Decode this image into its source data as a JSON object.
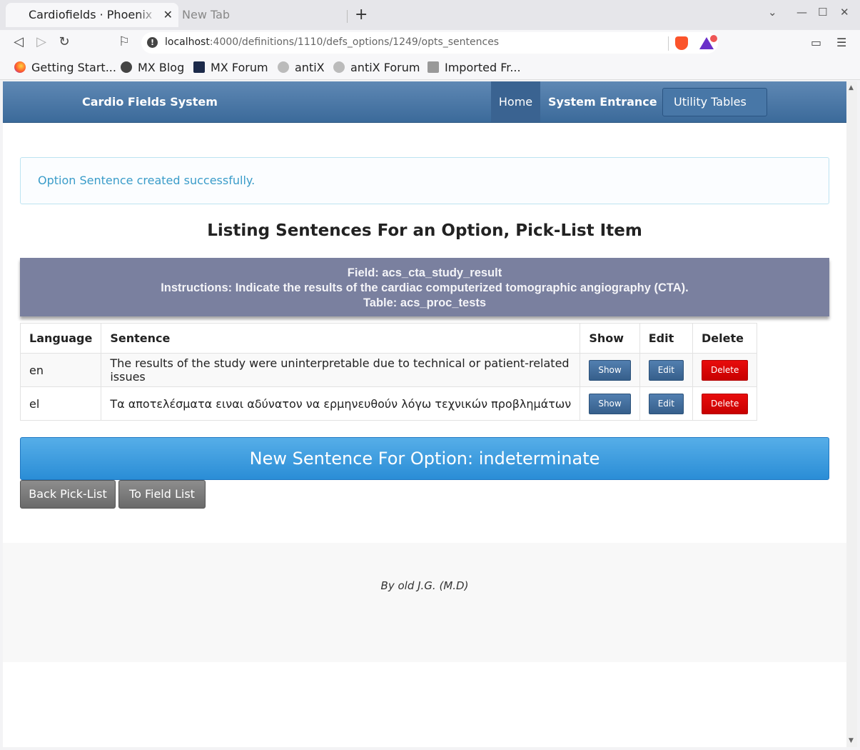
{
  "browser": {
    "tabs": [
      {
        "title": "Cardiofields · Phoenix Framework"
      },
      {
        "title": "New Tab"
      }
    ],
    "url": {
      "host": "localhost",
      "rest": ":4000/definitions/1110/defs_options/1249/opts_sentences"
    },
    "bookmarks": [
      {
        "label": "Getting Start...",
        "icon": "firefox-icon"
      },
      {
        "label": "MX Blog",
        "icon": "globe-icon"
      },
      {
        "label": "MX Forum",
        "icon": "mx-icon"
      },
      {
        "label": "antiX",
        "icon": "antix-icon"
      },
      {
        "label": "antiX Forum",
        "icon": "antix-icon"
      },
      {
        "label": "Imported Fr...",
        "icon": "folder-icon"
      }
    ]
  },
  "navbar": {
    "brand": "Cardio Fields System",
    "home": "Home",
    "entrance": "System Entrance",
    "utility": "Utility Tables"
  },
  "alert": {
    "text": "Option Sentence created successfully."
  },
  "page_title": "Listing Sentences For an Option, Pick-List Item",
  "field_info": {
    "field": "Field: acs_cta_study_result",
    "instructions": "Instructions: Indicate the results of the cardiac computerized tomographic angiography (CTA).",
    "table": "Table: acs_proc_tests"
  },
  "table": {
    "headers": [
      "Language",
      "Sentence",
      "Show",
      "Edit",
      "Delete"
    ],
    "rows": [
      {
        "language": "en",
        "sentence": "The results of the study were uninterpretable due to technical or patient-related issues",
        "show": "Show",
        "edit": "Edit",
        "delete": "Delete"
      },
      {
        "language": "el",
        "sentence": "Τα αποτελέσματα ειναι αδύνατον να ερμηνευθούν λόγω τεχνικών προβλημάτων",
        "show": "Show",
        "edit": "Edit",
        "delete": "Delete"
      }
    ]
  },
  "new_button": "New Sentence For Option: indeterminate",
  "back_buttons": {
    "pick_list": "Back Pick-List",
    "field_list": "To Field List"
  },
  "footer": "By old J.G. (M.D)",
  "colors": {
    "navbar": "#3b6a9a",
    "alert_text": "#3a9cc9",
    "field_box": "#7a809f",
    "new_button": "#2a8dd6",
    "delete": "#c80000"
  }
}
